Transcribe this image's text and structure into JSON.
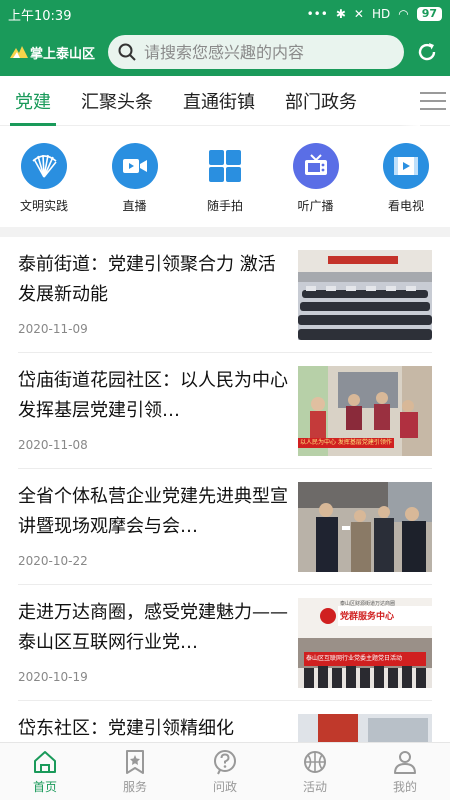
{
  "status": {
    "time": "上午10:39",
    "dots": "•••",
    "signal": "HD",
    "battery": "97"
  },
  "header": {
    "logo_text": "掌上泰山区",
    "search_placeholder": "请搜索您感兴趣的内容"
  },
  "tabs": [
    {
      "label": "党建"
    },
    {
      "label": "汇聚头条"
    },
    {
      "label": "直通街镇"
    },
    {
      "label": "部门政务"
    }
  ],
  "quick_links": [
    {
      "label": "文明实践",
      "icon": "fan-icon",
      "color": "#2a8fe0"
    },
    {
      "label": "直播",
      "icon": "video-camera-icon",
      "color": "#2a8fe0"
    },
    {
      "label": "随手拍",
      "icon": "grid-icon",
      "color": "#2a8fe0"
    },
    {
      "label": "听广播",
      "icon": "tv-radio-icon",
      "color": "#5a6ee6"
    },
    {
      "label": "看电视",
      "icon": "film-icon",
      "color": "#2a8fe0"
    }
  ],
  "news": [
    {
      "title": "泰前街道：党建引领聚合力 激活发展新动能",
      "date": "2020-11-09"
    },
    {
      "title": "岱庙街道花园社区：以人民为中心 发挥基层党建引领…",
      "date": "2020-11-08"
    },
    {
      "title": "全省个体私营企业党建先进典型宣讲暨现场观摩会与会…",
      "date": "2020-10-22"
    },
    {
      "title": "走进万达商圈，感受党建魅力——泰山区互联网行业党…",
      "date": "2020-10-19"
    },
    {
      "title": "岱东社区：党建引领精细化",
      "date": ""
    }
  ],
  "thumb_captions": {
    "t4_sign": "党群服务中心",
    "t4_top": "泰山区财源街道万达商圈",
    "t4_banner": "泰山区互联网行业党委主题党日活动",
    "t2_caption": "以人民为中心 发挥基层党建引领作用"
  },
  "bottom_nav": [
    {
      "label": "首页",
      "icon": "home-icon",
      "active": true
    },
    {
      "label": "服务",
      "icon": "star-bookmark-icon",
      "active": false
    },
    {
      "label": "问政",
      "icon": "question-icon",
      "active": false
    },
    {
      "label": "活动",
      "icon": "basketball-icon",
      "active": false
    },
    {
      "label": "我的",
      "icon": "user-icon",
      "active": false
    }
  ],
  "colors": {
    "brand_green": "#1a9a5a",
    "icon_blue": "#2a8fe0",
    "icon_purple": "#5a6ee6"
  }
}
